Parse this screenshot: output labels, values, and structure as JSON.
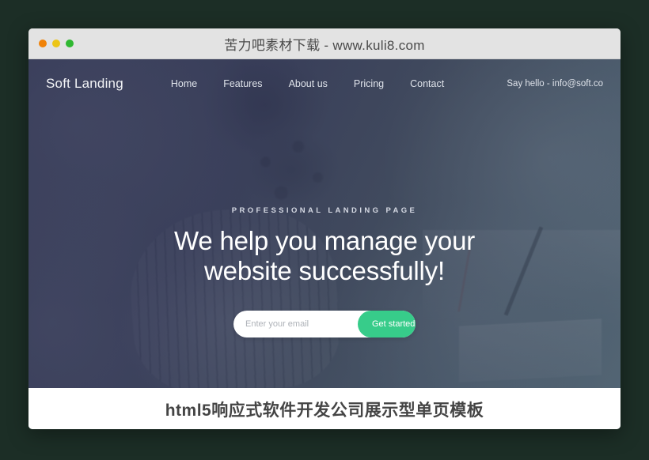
{
  "window": {
    "title": "苦力吧素材下载 - www.kuli8.com",
    "controls": [
      {
        "name": "close",
        "color": "#f08208"
      },
      {
        "name": "minimize",
        "color": "#ecc516"
      },
      {
        "name": "maximize",
        "color": "#2fb831"
      }
    ]
  },
  "site": {
    "logo": "Soft Landing",
    "nav": [
      {
        "label": "Home"
      },
      {
        "label": "Features"
      },
      {
        "label": "About us"
      },
      {
        "label": "Pricing"
      },
      {
        "label": "Contact"
      }
    ],
    "contact": "Say hello - info@soft.co"
  },
  "hero": {
    "eyebrow": "PROFESSIONAL LANDING PAGE",
    "headline_line1": "We help you manage your",
    "headline_line2": "website successfully!",
    "form": {
      "email_placeholder": "Enter your email",
      "email_value": "",
      "submit_label": "Get started",
      "accent_color": "#37cc8a"
    }
  },
  "caption": {
    "text": "html5响应式软件开发公司展示型单页模板"
  },
  "colors": {
    "page_background": "#1c2e26",
    "titlebar_background": "#e3e3e3",
    "hero_overlay": "#3d4260",
    "accent_green": "#37cc8a"
  }
}
